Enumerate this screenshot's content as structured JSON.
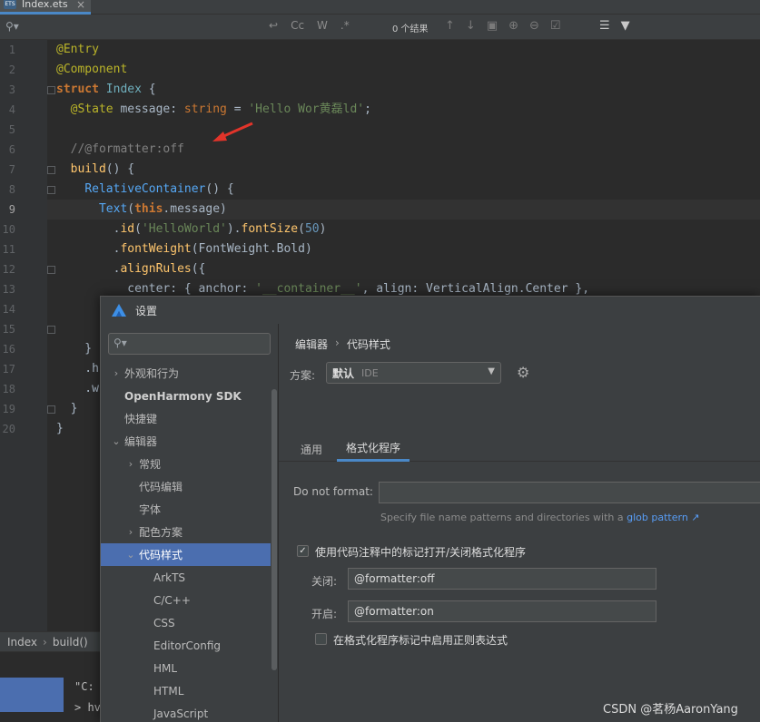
{
  "editor": {
    "tab_label": "Index.ets",
    "find": {
      "results_label": "0 个结果"
    },
    "lines": [
      {
        "num": "1",
        "html": "<span class='anno'>@Entry</span>"
      },
      {
        "num": "2",
        "html": "<span class='anno'>@Component</span>"
      },
      {
        "num": "3",
        "html": "<span class='kw'>struct</span> <span class='cls'>Index</span> {"
      },
      {
        "num": "4",
        "html": "  <span class='anno'>@State</span> message: <span class='kw2'>string</span> = <span class='str'>'Hello Wor黄磊ld'</span>;"
      },
      {
        "num": "5",
        "html": ""
      },
      {
        "num": "6",
        "html": "  <span class='cmt'>//@formatter:off</span>"
      },
      {
        "num": "7",
        "html": "  <span class='fn'>build</span>() {"
      },
      {
        "num": "8",
        "html": "    <span class='comp'>RelativeContainer</span>() {"
      },
      {
        "num": "9",
        "html": "      <span class='comp'>Text</span>(<span class='kw'>this</span>.message)"
      },
      {
        "num": "10",
        "html": "        .<span class='fn'>id</span>(<span class='str'>'HelloWorld'</span>).<span class='fn'>fontSize</span>(<span class='num'>50</span>)"
      },
      {
        "num": "11",
        "html": "        .<span class='fn'>fontWeight</span>(FontWeight.Bold)"
      },
      {
        "num": "12",
        "html": "        .<span class='fn'>alignRules</span>({"
      },
      {
        "num": "13",
        "html": "          center: { anchor: <span class='str'>'__container__'</span>, align: VerticalAlign.Center },"
      },
      {
        "num": "14",
        "html": ""
      },
      {
        "num": "15",
        "html": ""
      },
      {
        "num": "16",
        "html": "    }"
      },
      {
        "num": "17",
        "html": "    .h"
      },
      {
        "num": "18",
        "html": "    .w"
      },
      {
        "num": "19",
        "html": "  }"
      },
      {
        "num": "20",
        "html": "}"
      }
    ],
    "breadcrumb": [
      "Index",
      "build()"
    ],
    "terminal": [
      "\"C:",
      "> hv"
    ]
  },
  "dialog": {
    "title": "设置",
    "sidebar": [
      {
        "label": "外观和行为",
        "chev": "›",
        "indent": 0,
        "bold": false
      },
      {
        "label": "OpenHarmony SDK",
        "chev": "",
        "indent": 0,
        "bold": true
      },
      {
        "label": "快捷键",
        "chev": "",
        "indent": 0,
        "bold": false
      },
      {
        "label": "编辑器",
        "chev": "⌄",
        "indent": 0,
        "bold": false
      },
      {
        "label": "常规",
        "chev": "›",
        "indent": 1,
        "bold": false
      },
      {
        "label": "代码编辑",
        "chev": "",
        "indent": 1,
        "bold": false
      },
      {
        "label": "字体",
        "chev": "",
        "indent": 1,
        "bold": false
      },
      {
        "label": "配色方案",
        "chev": "›",
        "indent": 1,
        "bold": false
      },
      {
        "label": "代码样式",
        "chev": "⌄",
        "indent": 1,
        "bold": false,
        "selected": true
      },
      {
        "label": "ArkTS",
        "chev": "",
        "indent": 2,
        "bold": false
      },
      {
        "label": "C/C++",
        "chev": "",
        "indent": 2,
        "bold": false
      },
      {
        "label": "CSS",
        "chev": "",
        "indent": 2,
        "bold": false
      },
      {
        "label": "EditorConfig",
        "chev": "",
        "indent": 2,
        "bold": false
      },
      {
        "label": "HML",
        "chev": "",
        "indent": 2,
        "bold": false
      },
      {
        "label": "HTML",
        "chev": "",
        "indent": 2,
        "bold": false
      },
      {
        "label": "JavaScript",
        "chev": "",
        "indent": 2,
        "bold": false
      }
    ],
    "breadcrumb": [
      "编辑器",
      "代码样式"
    ],
    "scheme": {
      "label": "方案:",
      "value": "默认",
      "sub": "IDE"
    },
    "tabs": [
      "通用",
      "格式化程序"
    ],
    "formatter": {
      "do_not_format_label": "Do not format:",
      "hint_text": "Specify file name patterns and directories with a",
      "hint_link": "glob pattern ↗",
      "enable_markers_label": "使用代码注释中的标记打开/关闭格式化程序",
      "off_label": "关闭:",
      "off_value": "@formatter:off",
      "on_label": "开启:",
      "on_value": "@formatter:on",
      "regex_label": "在格式化程序标记中启用正则表达式"
    }
  },
  "watermark": "CSDN @茗杨AaronYang"
}
